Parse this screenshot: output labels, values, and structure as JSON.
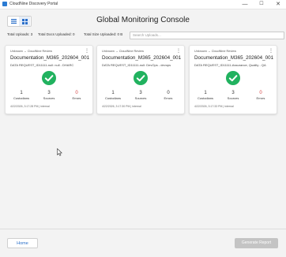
{
  "window": {
    "title": "CloudNine Discovery Portal",
    "controls": {
      "minimize": "—",
      "maximize": "☐",
      "close": "✕"
    }
  },
  "toolbar": {
    "view_modes": [
      {
        "name": "list-view",
        "icon": "list-icon",
        "active": false
      },
      {
        "name": "grid-view",
        "icon": "grid-icon",
        "active": true
      }
    ]
  },
  "page": {
    "title": "Global Monitoring Console"
  },
  "stats": {
    "uploads": "Total Uploads: 3",
    "docs": "Total Docs Uploaded: 0",
    "size": "Total Size Uploaded: 0 B"
  },
  "search": {
    "placeholder": "Search Uploads..."
  },
  "colors": {
    "accent": "#2a6fc9",
    "success": "#21b25f",
    "error": "#d64545",
    "disabled": "#c4c4c4"
  },
  "cards": [
    {
      "workflow": "Unknown → CloudNine Review",
      "title": "Documentation_M365_202604_001",
      "request": "DATA REQUEST_ID11111-null: null - DHARC",
      "status_icon": "check-circle-icon",
      "custodians": {
        "value": "1",
        "label": "Custodians"
      },
      "sources": {
        "value": "3",
        "label": "Sources"
      },
      "errors": {
        "value": "0",
        "label": "Errors"
      },
      "footer": "4/22/2026, 3:17:28 PM | internal"
    },
    {
      "workflow": "Unknown → CloudNine Review",
      "title": "Documentation_M365_202604_001",
      "request": "DATA REQUEST_ID11111-null: DevOps - devops",
      "status_icon": "check-circle-icon",
      "custodians": {
        "value": "1",
        "label": "Custodians"
      },
      "sources": {
        "value": "3",
        "label": "Sources"
      },
      "errors": {
        "value": "0",
        "label": "Errors"
      },
      "footer": "4/22/2026, 3:17:30 PM | internal"
    },
    {
      "workflow": "Unknown → CloudNine Review",
      "title": "Documentation_M365_202604_001",
      "request": "DATA REQUEST_ID11111-Assurance, Quality - QA",
      "status_icon": "check-circle-icon",
      "custodians": {
        "value": "1",
        "label": "Custodians"
      },
      "sources": {
        "value": "3",
        "label": "Sources"
      },
      "errors": {
        "value": "0",
        "label": "Errors"
      },
      "footer": "4/22/2026, 3:17:33 PM | internal"
    }
  ],
  "footer": {
    "home_label": "Home",
    "generate_label": "Generate Report"
  }
}
